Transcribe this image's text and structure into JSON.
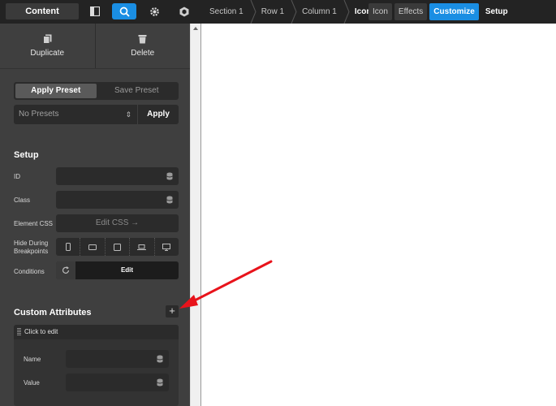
{
  "topbar": {
    "content_label": "Content",
    "icons": [
      "layout-icon",
      "search-icon",
      "gear-icon",
      "cube-icon"
    ],
    "breadcrumbs": [
      "Section 1",
      "Row 1",
      "Column 1",
      "Icon"
    ],
    "tabs": [
      "Icon",
      "Effects",
      "Customize",
      "Setup"
    ],
    "active_tab": "Customize"
  },
  "actions": {
    "duplicate": "Duplicate",
    "delete": "Delete"
  },
  "presets": {
    "apply_preset": "Apply Preset",
    "save_preset": "Save Preset",
    "select_value": "No Presets",
    "apply": "Apply"
  },
  "setup": {
    "title": "Setup",
    "id_label": "ID",
    "class_label": "Class",
    "element_css_label": "Element CSS",
    "edit_css": "Edit CSS →",
    "hide_label": "Hide During Breakpoints",
    "conditions_label": "Conditions",
    "edit": "Edit"
  },
  "custom_attributes": {
    "title": "Custom Attributes",
    "add": "+",
    "item_label": "Click to edit",
    "name_label": "Name",
    "value_label": "Value"
  },
  "colors": {
    "accent": "#1a8ee3",
    "annotation_arrow": "#e8131b"
  }
}
